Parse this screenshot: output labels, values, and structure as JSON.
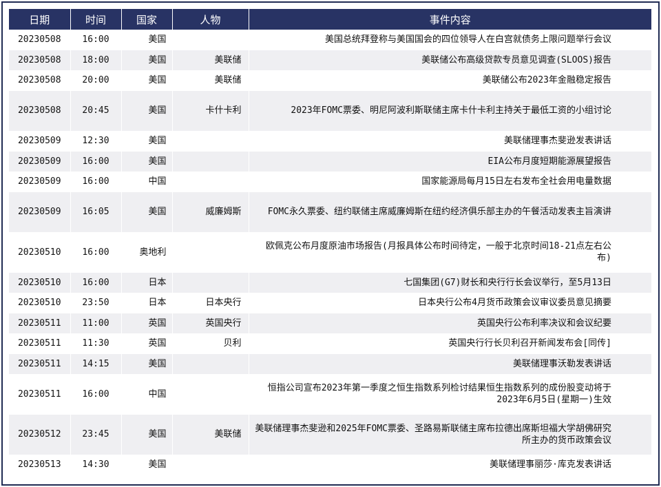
{
  "table": {
    "headers": [
      "日期",
      "时间",
      "国家",
      "人物",
      "事件内容"
    ],
    "rows": [
      {
        "date": "20230508",
        "time": "16:00",
        "country": "美国",
        "person": "",
        "event": "美国总统拜登称与美国国会的四位领导人在白宫就债务上限问题举行会议"
      },
      {
        "date": "20230508",
        "time": "18:00",
        "country": "美国",
        "person": "美联储",
        "event": "美联储公布高级贷款专员意见调查(SLOOS)报告"
      },
      {
        "date": "20230508",
        "time": "20:00",
        "country": "美国",
        "person": "美联储",
        "event": "美联储公布2023年金融稳定报告"
      },
      {
        "date": "20230508",
        "time": "20:45",
        "country": "美国",
        "person": "卡什卡利",
        "event": "2023年FOMC票委、明尼阿波利斯联储主席卡什卡利主持关于最低工资的小组讨论"
      },
      {
        "date": "20230509",
        "time": "12:30",
        "country": "美国",
        "person": "",
        "event": "美联储理事杰斐逊发表讲话"
      },
      {
        "date": "20230509",
        "time": "16:00",
        "country": "美国",
        "person": "",
        "event": "EIA公布月度短期能源展望报告"
      },
      {
        "date": "20230509",
        "time": "16:00",
        "country": "中国",
        "person": "",
        "event": "国家能源局每月15日左右发布全社会用电量数据"
      },
      {
        "date": "20230509",
        "time": "16:05",
        "country": "美国",
        "person": "威廉姆斯",
        "event": "FOMC永久票委、纽约联储主席威廉姆斯在纽约经济俱乐部主办的午餐活动发表主旨演讲"
      },
      {
        "date": "20230510",
        "time": "16:00",
        "country": "奥地利",
        "person": "",
        "event": "欧佩克公布月度原油市场报告(月报具体公布时间待定，一般于北京时间18-21点左右公布)"
      },
      {
        "date": "20230510",
        "time": "16:00",
        "country": "日本",
        "person": "",
        "event": "七国集团(G7)财长和央行行长会议举行，至5月13日"
      },
      {
        "date": "20230510",
        "time": "23:50",
        "country": "日本",
        "person": "日本央行",
        "event": "日本央行公布4月货币政策会议审议委员意见摘要"
      },
      {
        "date": "20230511",
        "time": "11:00",
        "country": "英国",
        "person": "英国央行",
        "event": "英国央行公布利率决议和会议纪要"
      },
      {
        "date": "20230511",
        "time": "11:30",
        "country": "英国",
        "person": "贝利",
        "event": "英国央行行长贝利召开新闻发布会[同传]"
      },
      {
        "date": "20230511",
        "time": "14:15",
        "country": "美国",
        "person": "",
        "event": "美联储理事沃勒发表讲话"
      },
      {
        "date": "20230511",
        "time": "16:00",
        "country": "中国",
        "person": "",
        "event": "恒指公司宣布2023年第一季度之恒生指数系列检讨结果恒生指数系列的成份股变动将于2023年6月5日(星期一)生效"
      },
      {
        "date": "20230512",
        "time": "23:45",
        "country": "美国",
        "person": "美联储",
        "event": "美联储理事杰斐逊和2025年FOMC票委、圣路易斯联储主席布拉德出席斯坦福大学胡佛研究所主办的货币政策会议"
      },
      {
        "date": "20230513",
        "time": "14:30",
        "country": "美国",
        "person": "",
        "event": "美联储理事丽莎·库克发表讲话"
      }
    ]
  }
}
